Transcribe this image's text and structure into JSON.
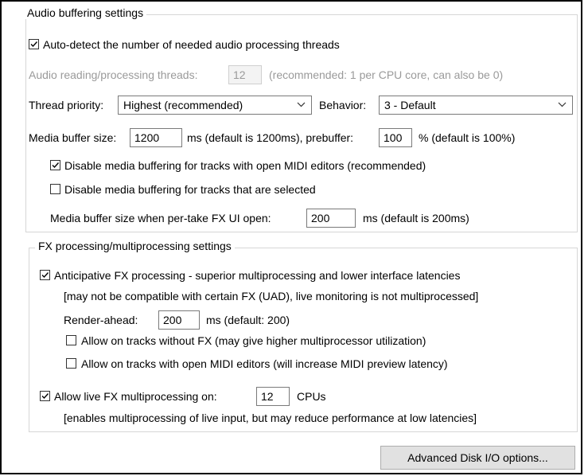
{
  "audio_group": {
    "title": "Audio buffering settings",
    "auto_detect": {
      "label": "Auto-detect the number of needed audio processing threads",
      "checked": true
    },
    "threads": {
      "label": "Audio reading/processing threads:",
      "value": "12",
      "note": "(recommended: 1 per CPU core, can also be 0)"
    },
    "thread_priority": {
      "label": "Thread priority:",
      "value": "Highest (recommended)"
    },
    "behavior": {
      "label": "Behavior:",
      "value": "3 - Default"
    },
    "media_buffer": {
      "label": "Media buffer size:",
      "value": "1200",
      "after": "ms (default is 1200ms), prebuffer:",
      "prebuffer_value": "100",
      "prebuffer_note": "% (default is 100%)"
    },
    "disable_midi": {
      "label": "Disable media buffering for tracks with open MIDI editors (recommended)",
      "checked": true
    },
    "disable_selected": {
      "label": "Disable media buffering for tracks that are selected",
      "checked": false
    },
    "per_take": {
      "label": "Media buffer size when per-take FX UI open:",
      "value": "200",
      "note": "ms (default is 200ms)"
    }
  },
  "fx_group": {
    "title": "FX processing/multiprocessing settings",
    "anticipative": {
      "label": "Anticipative FX processing - superior multiprocessing and lower interface latencies",
      "checked": true,
      "note": "[may not be compatible with certain FX (UAD), live monitoring is not multiprocessed]"
    },
    "render_ahead": {
      "label": "Render-ahead:",
      "value": "200",
      "note": "ms (default: 200)"
    },
    "allow_no_fx": {
      "label": "Allow on tracks without FX (may give higher multiprocessor utilization)",
      "checked": false
    },
    "allow_midi": {
      "label": "Allow on tracks with open MIDI editors (will increase MIDI preview latency)",
      "checked": false
    },
    "live_fx": {
      "label": "Allow live FX multiprocessing on:",
      "checked": true,
      "value": "12",
      "unit": "CPUs",
      "note": "[enables multiprocessing of live input, but may reduce performance at low latencies]"
    }
  },
  "advanced_button": {
    "label": "Advanced Disk I/O options..."
  }
}
